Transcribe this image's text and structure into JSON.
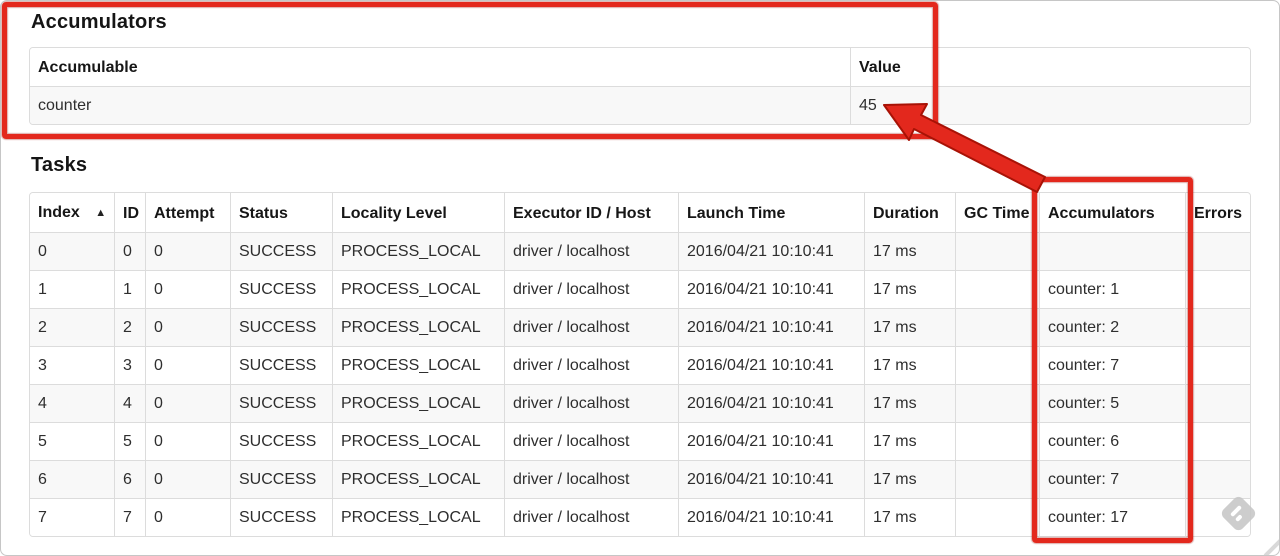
{
  "colors": {
    "annotation_red": "#e3281d",
    "annotation_red_dark": "#a81206",
    "row_stripe": "#f8f8f8",
    "table_border": "#dcdcdc"
  },
  "icons": {
    "sort_asc": "▲",
    "watermark": "skitch-diamond"
  },
  "accumulators_section": {
    "title": "Accumulators",
    "headers": [
      "Accumulable",
      "Value"
    ],
    "rows": [
      {
        "accumulable": "counter",
        "value": "45"
      }
    ]
  },
  "tasks_section": {
    "title": "Tasks",
    "headers": [
      "Index",
      "ID",
      "Attempt",
      "Status",
      "Locality Level",
      "Executor ID / Host",
      "Launch Time",
      "Duration",
      "GC Time",
      "Accumulators",
      "Errors"
    ],
    "fields": [
      "index",
      "id",
      "attempt",
      "status",
      "locality_level",
      "executor_id_host",
      "launch_time",
      "duration",
      "gc_time",
      "accumulators",
      "errors"
    ],
    "rows": [
      {
        "index": "0",
        "id": "0",
        "attempt": "0",
        "status": "SUCCESS",
        "locality_level": "PROCESS_LOCAL",
        "executor_id_host": "driver / localhost",
        "launch_time": "2016/04/21 10:10:41",
        "duration": "17 ms",
        "gc_time": "",
        "accumulators": "",
        "errors": ""
      },
      {
        "index": "1",
        "id": "1",
        "attempt": "0",
        "status": "SUCCESS",
        "locality_level": "PROCESS_LOCAL",
        "executor_id_host": "driver / localhost",
        "launch_time": "2016/04/21 10:10:41",
        "duration": "17 ms",
        "gc_time": "",
        "accumulators": "counter: 1",
        "errors": ""
      },
      {
        "index": "2",
        "id": "2",
        "attempt": "0",
        "status": "SUCCESS",
        "locality_level": "PROCESS_LOCAL",
        "executor_id_host": "driver / localhost",
        "launch_time": "2016/04/21 10:10:41",
        "duration": "17 ms",
        "gc_time": "",
        "accumulators": "counter: 2",
        "errors": ""
      },
      {
        "index": "3",
        "id": "3",
        "attempt": "0",
        "status": "SUCCESS",
        "locality_level": "PROCESS_LOCAL",
        "executor_id_host": "driver / localhost",
        "launch_time": "2016/04/21 10:10:41",
        "duration": "17 ms",
        "gc_time": "",
        "accumulators": "counter: 7",
        "errors": ""
      },
      {
        "index": "4",
        "id": "4",
        "attempt": "0",
        "status": "SUCCESS",
        "locality_level": "PROCESS_LOCAL",
        "executor_id_host": "driver / localhost",
        "launch_time": "2016/04/21 10:10:41",
        "duration": "17 ms",
        "gc_time": "",
        "accumulators": "counter: 5",
        "errors": ""
      },
      {
        "index": "5",
        "id": "5",
        "attempt": "0",
        "status": "SUCCESS",
        "locality_level": "PROCESS_LOCAL",
        "executor_id_host": "driver / localhost",
        "launch_time": "2016/04/21 10:10:41",
        "duration": "17 ms",
        "gc_time": "",
        "accumulators": "counter: 6",
        "errors": ""
      },
      {
        "index": "6",
        "id": "6",
        "attempt": "0",
        "status": "SUCCESS",
        "locality_level": "PROCESS_LOCAL",
        "executor_id_host": "driver / localhost",
        "launch_time": "2016/04/21 10:10:41",
        "duration": "17 ms",
        "gc_time": "",
        "accumulators": "counter: 7",
        "errors": ""
      },
      {
        "index": "7",
        "id": "7",
        "attempt": "0",
        "status": "SUCCESS",
        "locality_level": "PROCESS_LOCAL",
        "executor_id_host": "driver / localhost",
        "launch_time": "2016/04/21 10:10:41",
        "duration": "17 ms",
        "gc_time": "",
        "accumulators": "counter: 17",
        "errors": ""
      }
    ]
  }
}
